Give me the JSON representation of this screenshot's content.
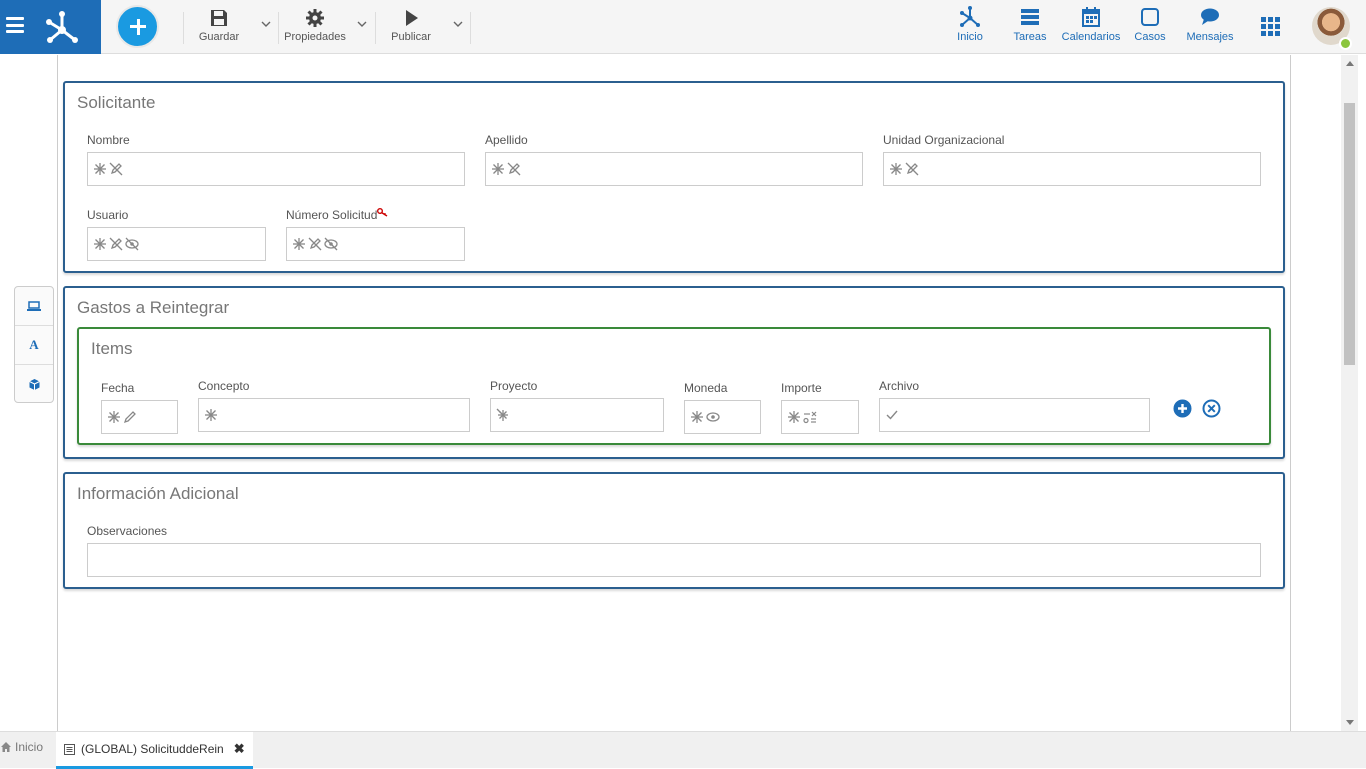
{
  "toolbar": {
    "save_label": "Guardar",
    "properties_label": "Propiedades",
    "publish_label": "Publicar"
  },
  "nav": {
    "home_label": "Inicio",
    "tasks_label": "Tareas",
    "calendars_label": "Calendarios",
    "cases_label": "Casos",
    "messages_label": "Mensajes"
  },
  "sidetools": [
    "laptop-icon",
    "font-icon",
    "cube-icon"
  ],
  "sidetool_letter": "A",
  "solicitante": {
    "title": "Solicitante",
    "nombre_label": "Nombre",
    "apellido_label": "Apellido",
    "unidad_label": "Unidad Organizacional",
    "usuario_label": "Usuario",
    "numero_label": "Número Solicitud"
  },
  "gastos": {
    "title": "Gastos a Reintegrar",
    "items_title": "Items",
    "fecha_label": "Fecha",
    "concepto_label": "Concepto",
    "proyecto_label": "Proyecto",
    "moneda_label": "Moneda",
    "importe_label": "Importe",
    "archivo_label": "Archivo"
  },
  "info": {
    "title": "Información Adicional",
    "observaciones_label": "Observaciones"
  },
  "tabs": {
    "home_label": "Inicio",
    "active_label": "(GLOBAL) SolicituddeRein",
    "close_glyph": "✖"
  },
  "colors": {
    "brand": "#1e6db7",
    "accent": "#1a9ae1",
    "panel_border": "#2b5f8f",
    "subpanel_border": "#3a8a3a"
  }
}
